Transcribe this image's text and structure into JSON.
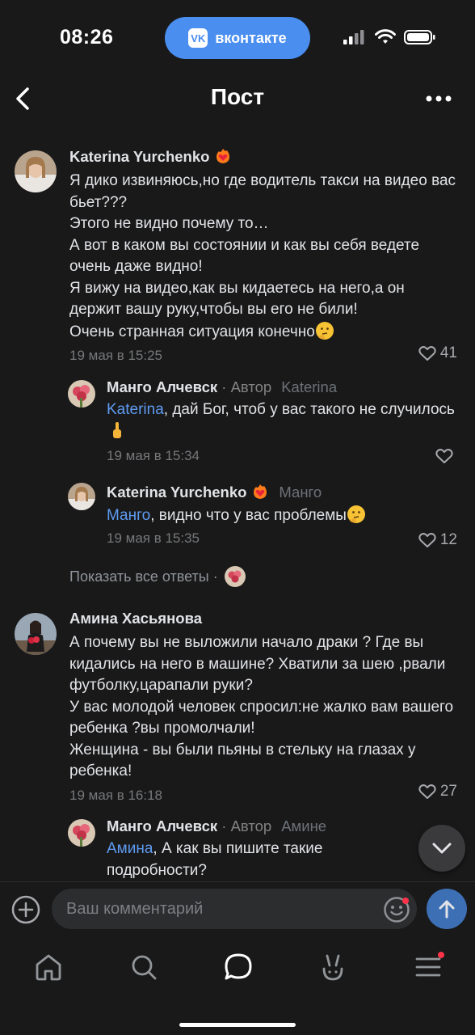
{
  "status_bar": {
    "time": "08:26",
    "app_pill": "вконтакте",
    "app_logo": "VK"
  },
  "header": {
    "title": "Пост"
  },
  "comments": [
    {
      "author": "Katerina Yurchenko",
      "text": "Я дико извиняюсь,но где водитель такси на видео вас бьет???\nЭтого не видно почему то…\nА вот в каком вы состоянии и как вы себя ведете очень даже видно!\nЯ вижу на видео,как вы кидаетесь на него,а он держит вашу руку,чтобы вы его не били!\nОчень странная ситуация конечно",
      "date": "19 мая в 15:25",
      "likes": "41",
      "replies": [
        {
          "author": "Манго Алчевск",
          "author_suffix": " · Автор",
          "addressee": "Katerina",
          "mention": "Katerina",
          "text": ", дай Бог, чтоб у вас такого не случилось",
          "date": "19 мая в 15:34",
          "likes": ""
        },
        {
          "author": "Katerina Yurchenko",
          "author_suffix": "",
          "addressee": "Манго",
          "mention": "Манго",
          "text": ", видно что у вас проблемы",
          "date": "19 мая в 15:35",
          "likes": "12"
        }
      ],
      "show_all": "Показать все ответы ·"
    },
    {
      "author": "Амина Хасьянова",
      "text": "А почему вы не выложили начало драки ? Где вы кидались на него в машине? Хватили за шею ,рвали футболку,царапали руки?\nУ вас молодой человек спросил:не жалко вам вашего ребенка ?вы промолчали!\nЖенщина - вы были пьяны в стельку на глазах у ребенка!",
      "date": "19 мая в 16:18",
      "likes": "27",
      "replies": [
        {
          "author": "Манго Алчевск",
          "author_suffix": " · Автор",
          "addressee": "Амине",
          "mention": "Амина",
          "text": ", А как вы пишите такие подробности?",
          "date": "",
          "likes": ""
        }
      ]
    }
  ],
  "input": {
    "placeholder": "Ваш комментарий"
  },
  "colors": {
    "background": "#19191a",
    "accent": "#5e9bf0",
    "pill": "#4a8ef0",
    "send": "#3d6fb5",
    "notification_dot": "#ff3347"
  },
  "icons": [
    "back-icon",
    "more-icon",
    "heart-icon",
    "plus-icon",
    "sticker-icon",
    "send-arrow-icon",
    "chevron-down-icon",
    "home-icon",
    "search-icon",
    "messages-icon",
    "clips-icon",
    "menu-icon"
  ]
}
